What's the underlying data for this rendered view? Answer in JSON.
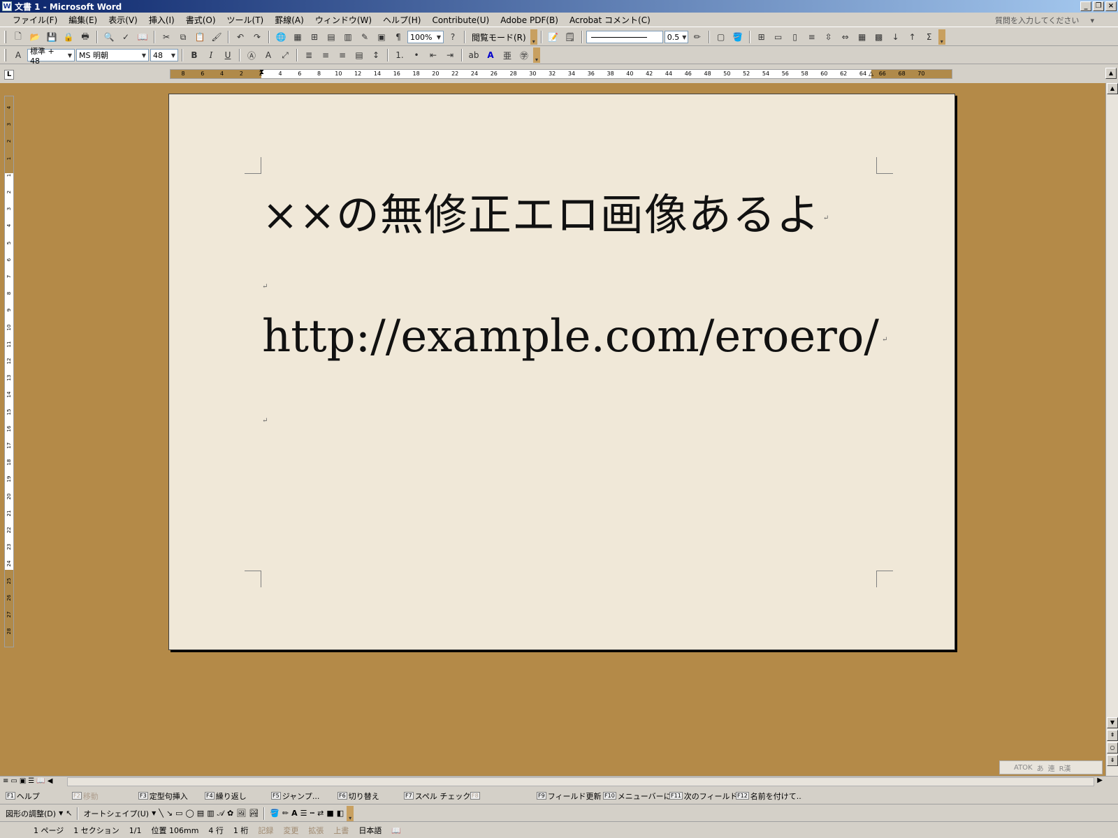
{
  "window": {
    "title": "文書 1 - Microsoft Word",
    "app_icon": "W"
  },
  "menu": {
    "items": [
      "ファイル(F)",
      "編集(E)",
      "表示(V)",
      "挿入(I)",
      "書式(O)",
      "ツール(T)",
      "罫線(A)",
      "ウィンドウ(W)",
      "ヘルプ(H)",
      "Contribute(U)",
      "Adobe PDF(B)",
      "Acrobat コメント(C)"
    ],
    "ask_placeholder": "質問を入力してください"
  },
  "toolbar": {
    "zoom": "100%",
    "read_mode": "閲覧モード(R)",
    "line_weight": "0.5"
  },
  "format": {
    "style": "標準 + 48",
    "font": "MS 明朝",
    "size": "48",
    "bold": "B",
    "italic": "I",
    "underline": "U"
  },
  "ruler": {
    "ticks": [
      "8",
      "6",
      "4",
      "2",
      "2",
      "4",
      "6",
      "8",
      "10",
      "12",
      "14",
      "16",
      "18",
      "20",
      "22",
      "24",
      "26",
      "28",
      "30",
      "32",
      "34",
      "36",
      "38",
      "40",
      "42",
      "44",
      "46",
      "48",
      "50",
      "52",
      "54",
      "56",
      "58",
      "60",
      "62",
      "64",
      "66",
      "68",
      "70"
    ],
    "vticks": [
      "4",
      "3",
      "2",
      "1",
      "1",
      "2",
      "3",
      "4",
      "5",
      "6",
      "7",
      "8",
      "9",
      "10",
      "11",
      "12",
      "13",
      "14",
      "15",
      "16",
      "17",
      "18",
      "19",
      "20",
      "21",
      "22",
      "23",
      "24",
      "25",
      "26",
      "27",
      "28"
    ]
  },
  "document": {
    "line1": "××の無修正エロ画像あるよ",
    "line3": "http://example.com/eroero/",
    "para_mark": "↵"
  },
  "atok": [
    "ATOK",
    "あ",
    "連",
    "R漢"
  ],
  "fkeys": [
    {
      "key": "F1",
      "label": "ヘルプ",
      "enabled": true
    },
    {
      "key": "F2",
      "label": "移動",
      "enabled": false
    },
    {
      "key": "F3",
      "label": "定型句挿入",
      "enabled": true
    },
    {
      "key": "F4",
      "label": "繰り返し",
      "enabled": true
    },
    {
      "key": "F5",
      "label": "ジャンプ...",
      "enabled": true
    },
    {
      "key": "F6",
      "label": "切り替え",
      "enabled": true
    },
    {
      "key": "F7",
      "label": "スペル チェック...",
      "enabled": true
    },
    {
      "key": "F8",
      "label": "",
      "enabled": false
    },
    {
      "key": "F9",
      "label": "フィールド更新",
      "enabled": true
    },
    {
      "key": "F10",
      "label": "メニューバーに",
      "enabled": true
    },
    {
      "key": "F11",
      "label": "次のフィールド",
      "enabled": true
    },
    {
      "key": "F12",
      "label": "名前を付けて...",
      "enabled": true
    }
  ],
  "drawing": {
    "adjust": "図形の調整(D)",
    "autoshape": "オートシェイプ(U)"
  },
  "status": {
    "page": "1 ページ",
    "section": "1 セクション",
    "pages": "1/1",
    "position": "位置 106mm",
    "line": "4 行",
    "column": "1 桁",
    "rec": "記録",
    "trk": "変更",
    "ext": "拡張",
    "ovr": "上書",
    "lang": "日本語"
  },
  "colors": {
    "workspace": "#b48a48",
    "page": "#f0e8d8",
    "titlebar": "#0a246a"
  }
}
